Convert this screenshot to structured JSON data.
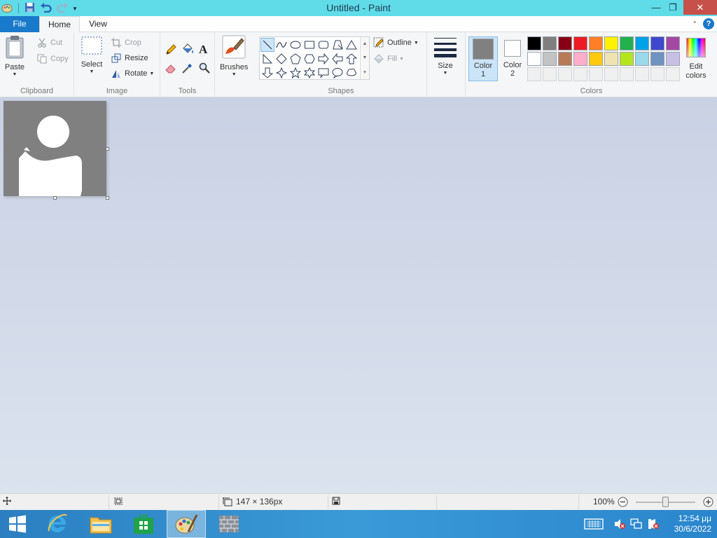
{
  "window": {
    "title": "Untitled - Paint",
    "minimize_glyph": "—",
    "restore_glyph": "❐",
    "close_glyph": "✕"
  },
  "tabs": {
    "file": "File",
    "home": "Home",
    "view": "View",
    "help_glyph": "?"
  },
  "ribbon": {
    "clipboard": {
      "label": "Clipboard",
      "paste": "Paste",
      "cut": "Cut",
      "copy": "Copy"
    },
    "image": {
      "label": "Image",
      "select": "Select",
      "crop": "Crop",
      "resize": "Resize",
      "rotate": "Rotate"
    },
    "tools": {
      "label": "Tools"
    },
    "brushes": {
      "label": "Brushes"
    },
    "shapes": {
      "label": "Shapes",
      "outline": "Outline",
      "fill": "Fill"
    },
    "size": {
      "label": "Size"
    },
    "colors": {
      "label": "Colors",
      "color1_a": "Color",
      "color1_b": "1",
      "color2_a": "Color",
      "color2_b": "2",
      "edit_a": "Edit",
      "edit_b": "colors",
      "color1_value": "#808080",
      "color2_value": "#ffffff",
      "palette_row1": [
        "#000000",
        "#7f7f7f",
        "#880015",
        "#ed1c24",
        "#ff7f27",
        "#fff200",
        "#22b14c",
        "#00a2e8",
        "#3f48cc",
        "#a349a4"
      ],
      "palette_row2": [
        "#ffffff",
        "#c3c3c3",
        "#b97a57",
        "#ffaec9",
        "#ffc90e",
        "#efe4b0",
        "#b5e61d",
        "#99d9ea",
        "#7092be",
        "#c8bfe7"
      ],
      "palette_row3": [
        "#f0f0f0",
        "#f0f0f0",
        "#f0f0f0",
        "#f0f0f0",
        "#f0f0f0",
        "#f0f0f0",
        "#f0f0f0",
        "#f0f0f0",
        "#f0f0f0",
        "#f0f0f0"
      ]
    }
  },
  "statusbar": {
    "image_size": "147 × 136px",
    "zoom": "100%"
  },
  "taskbar": {
    "time": "12:54 μμ",
    "date": "30/6/2022"
  }
}
